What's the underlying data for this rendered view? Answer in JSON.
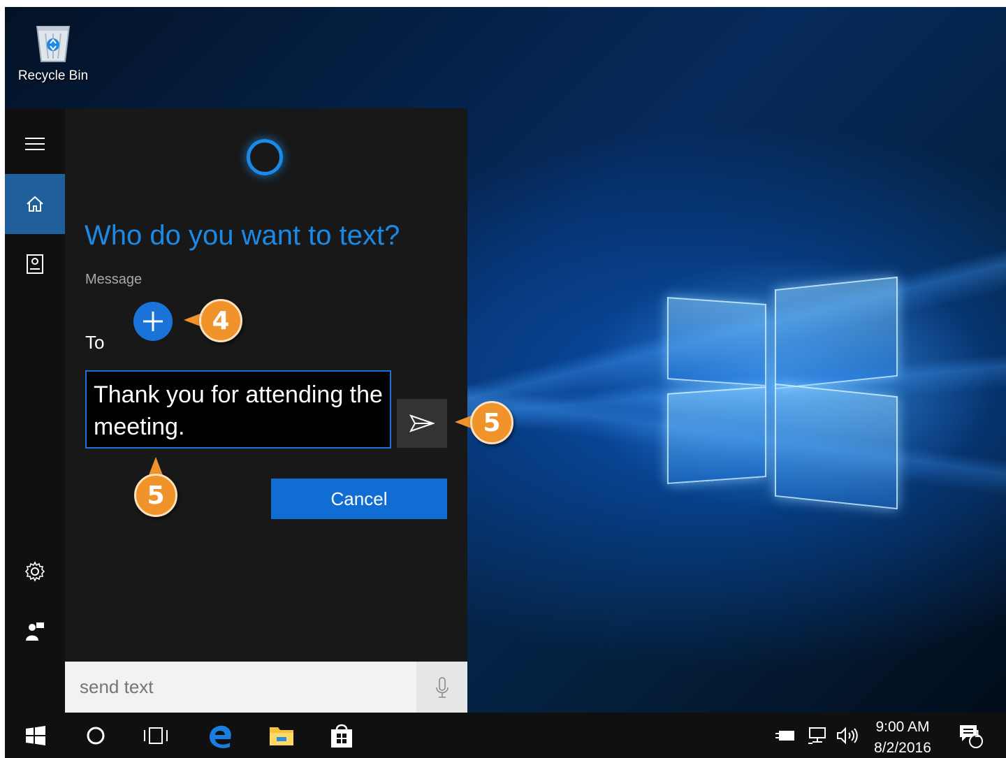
{
  "desktop": {
    "recycle_bin_label": "Recycle Bin"
  },
  "cortana": {
    "question": "Who do you want to text?",
    "message_label": "Message",
    "to_label": "To",
    "message_text": "Thank you for attending the meeting.",
    "cancel_label": "Cancel",
    "search_placeholder": "send text",
    "rail_icons": [
      "menu-icon",
      "home-icon",
      "notebook-icon",
      "settings-icon",
      "feedback-icon"
    ]
  },
  "callouts": {
    "add_recipient": "4",
    "send": "5",
    "message": "5"
  },
  "taskbar": {
    "time": "9:00 AM",
    "date": "8/2/2016",
    "notification_count": "1",
    "pinned": [
      "start-icon",
      "cortana-circle-icon",
      "task-view-icon",
      "edge-icon",
      "file-explorer-icon",
      "store-icon"
    ]
  },
  "colors": {
    "accent": "#1a8ae6",
    "callout": "#f0932b",
    "panel": "#181818",
    "rail": "#101010",
    "active_rail": "#1e5f9c"
  }
}
